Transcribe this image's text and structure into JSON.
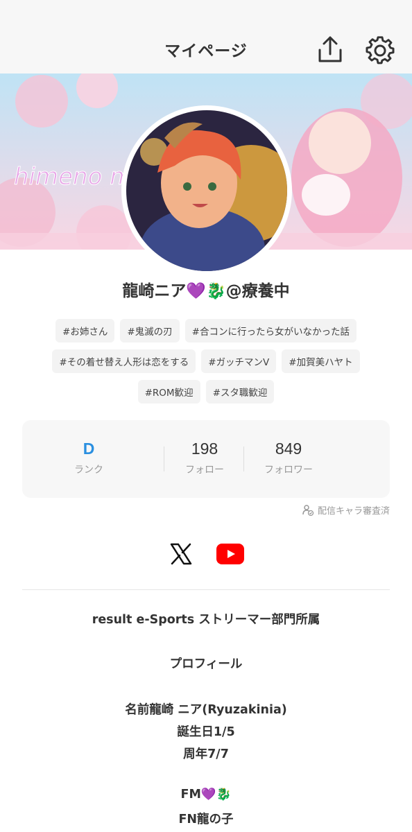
{
  "header": {
    "title": "マイページ",
    "share_icon": "share-icon",
    "settings_icon": "gear-icon"
  },
  "profile": {
    "name_prefix": "龍崎ニア",
    "heart": "💜",
    "dragon": "🐉",
    "name_suffix": "@療養中",
    "banner_logo_text": "himeno mio"
  },
  "tags": [
    "#お姉さん",
    "#鬼滅の刃",
    "#合コンに行ったら女がいなかった話",
    "#その着せ替え人形は恋をする",
    "#ガッチマンV",
    "#加賀美ハヤト",
    "#ROM歓迎",
    "#スタ職歓迎"
  ],
  "stats": {
    "rank_value": "D",
    "rank_label": "ランク",
    "follow_value": "198",
    "follow_label": "フォロー",
    "follower_value": "849",
    "follower_label": "フォロワー"
  },
  "verified_label": "配信キャラ審査済",
  "social": {
    "x_icon": "x-logo-icon",
    "youtube_icon": "youtube-icon"
  },
  "bio": {
    "line1": "result e-Sports ストリーマー部門所属",
    "line2": "プロフィール",
    "line3": "名前龍崎 ニア(Ryuzakinia)",
    "line4": "誕生日1/5",
    "line5": "周年7/7",
    "line6_prefix": "FM",
    "line7": "FN龍の子"
  },
  "colors": {
    "rank": "#2a8fe0",
    "heart": "#9b6fd6",
    "youtube": "#ff0000",
    "banner_pink": "#f7c9da"
  }
}
